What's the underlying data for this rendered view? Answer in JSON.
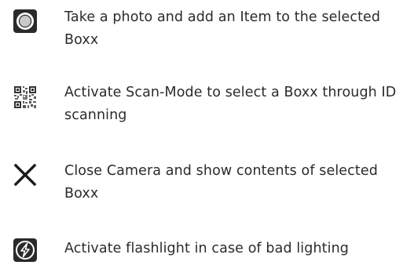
{
  "legend": {
    "items": [
      {
        "icon": "shutter-icon",
        "text": "Take a photo and add an Item to the selected Boxx"
      },
      {
        "icon": "qr-code-icon",
        "text": "Activate Scan-Mode to select a Boxx through ID scanning"
      },
      {
        "icon": "close-icon",
        "text": "Close Camera and show contents of selected Boxx"
      },
      {
        "icon": "flash-icon",
        "text": "Activate flashlight in case of bad lighting"
      }
    ]
  },
  "colors": {
    "text": "#2b2b2b",
    "icon_dark": "#1a1a1a",
    "icon_light": "#ffffff"
  }
}
